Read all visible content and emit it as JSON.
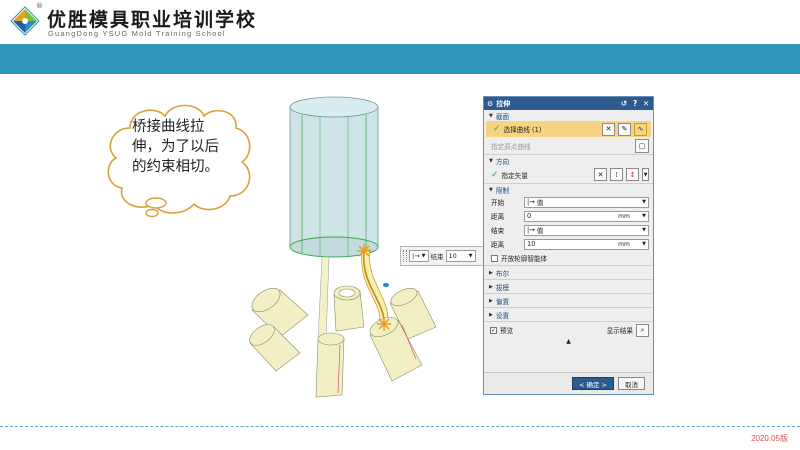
{
  "header": {
    "brand_cn": "优胜模具职业培训学校",
    "brand_en": "GuangDong YSUG Mold Training School",
    "reg_mark": "®"
  },
  "footer": {
    "version": "2020.05版"
  },
  "callout": {
    "text": "桥接曲线拉伸，为了以后的约束相切。"
  },
  "inline_popup": {
    "start_icon": "|→",
    "label": "结束",
    "value": "10"
  },
  "dialog": {
    "title": "拉伸",
    "title_buttons": [
      "↺",
      "?",
      "✕"
    ],
    "section": {
      "title": "截面",
      "select_curve": "选择曲线 (1)",
      "sketch_hint": "指定原点曲线"
    },
    "direction": {
      "title": "方向",
      "vector": "指定矢量"
    },
    "limits": {
      "title": "限制",
      "start_label": "开始",
      "start_value": "值",
      "start_distance_label": "距离",
      "start_distance": "0",
      "start_unit": "mm",
      "end_label": "结束",
      "end_value": "值",
      "end_distance_label": "距离",
      "end_distance": "10",
      "end_unit": "mm",
      "open_profile": "开放轮廓智能体"
    },
    "collapsed": [
      "布尔",
      "拔模",
      "偏置",
      "设置"
    ],
    "preview": "预览",
    "show_result": "显示结果",
    "ok": "< 确定 >",
    "cancel": "取消"
  }
}
